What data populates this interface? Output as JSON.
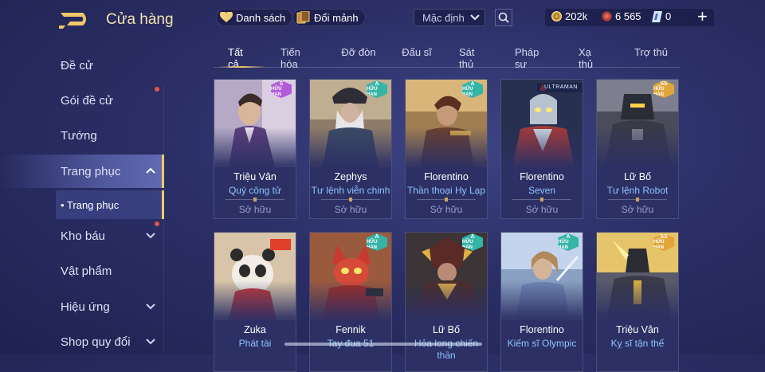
{
  "header": {
    "title": "Cửa hàng",
    "list_label": "Danh sách",
    "exchange_label": "Đổi mảnh",
    "sort_value": "Mặc định",
    "gold": "202k",
    "rubies": "6 565",
    "vouchers": "0",
    "add_label": "+"
  },
  "sidebar": {
    "items": [
      {
        "label": "Đề cử"
      },
      {
        "label": "Gói đề cử"
      },
      {
        "label": "Tướng"
      },
      {
        "label": "Trang phục"
      },
      {
        "label": "Kho báu"
      },
      {
        "label": "Vật phẩm"
      },
      {
        "label": "Hiệu ứng"
      },
      {
        "label": "Shop quy đổi"
      }
    ],
    "sub_item": "• Trang phục"
  },
  "tabs": [
    {
      "label": "Tất cả"
    },
    {
      "label": "Tiến hóa"
    },
    {
      "label": "Đỡ đòn"
    },
    {
      "label": "Đấu sĩ"
    },
    {
      "label": "Sát thủ"
    },
    {
      "label": "Pháp sư"
    },
    {
      "label": "Xạ thủ"
    },
    {
      "label": "Trợ thủ"
    }
  ],
  "cards": [
    {
      "hero": "Triệu Vân",
      "skin": "Quý công tử",
      "status": "Sở hữu",
      "rank": "S",
      "rank_sub": "HỮU HẠN",
      "badge_color": "#b25ad8"
    },
    {
      "hero": "Zephys",
      "skin": "Tư lệnh viễn chinh",
      "status": "Sở hữu",
      "rank": "A",
      "rank_sub": "HỮU HẠN",
      "badge_color": "#35b4a8"
    },
    {
      "hero": "Florentino",
      "skin": "Thần thoại Hy Lạp",
      "status": "Sở hữu",
      "rank": "A",
      "rank_sub": "HỮU HẠN",
      "badge_color": "#35b4a8"
    },
    {
      "hero": "Florentino",
      "skin": "Seven",
      "status": "Sở hữu",
      "frame_tag": "ULTRAMAN"
    },
    {
      "hero": "Lữ Bố",
      "skin": "Tư lệnh Robot",
      "status": "Sở hữu",
      "rank": "SS",
      "rank_sub": "HỮU HẠN",
      "badge_color": "#e1a53a"
    },
    {
      "hero": "Zuka",
      "skin": "Phát tài",
      "status": ""
    },
    {
      "hero": "Fennik",
      "skin": "Tay đua 51",
      "status": "",
      "rank": "A",
      "rank_sub": "HỮU HẠN",
      "badge_color": "#35b4a8"
    },
    {
      "hero": "Lữ Bố",
      "skin": "Hỏa long chiến thần",
      "status": "",
      "rank": "A",
      "rank_sub": "HỮU HẠN",
      "badge_color": "#35b4a8"
    },
    {
      "hero": "Florentino",
      "skin": "Kiếm sĩ Olympic",
      "status": "",
      "rank": "A",
      "rank_sub": "HỮU HẠN",
      "badge_color": "#35b4a8"
    },
    {
      "hero": "Triệu Vân",
      "skin": "Kỵ sĩ tận thế",
      "status": "",
      "rank": "SS",
      "rank_sub": "HỮU HẠN",
      "badge_color": "#e1a53a"
    }
  ]
}
